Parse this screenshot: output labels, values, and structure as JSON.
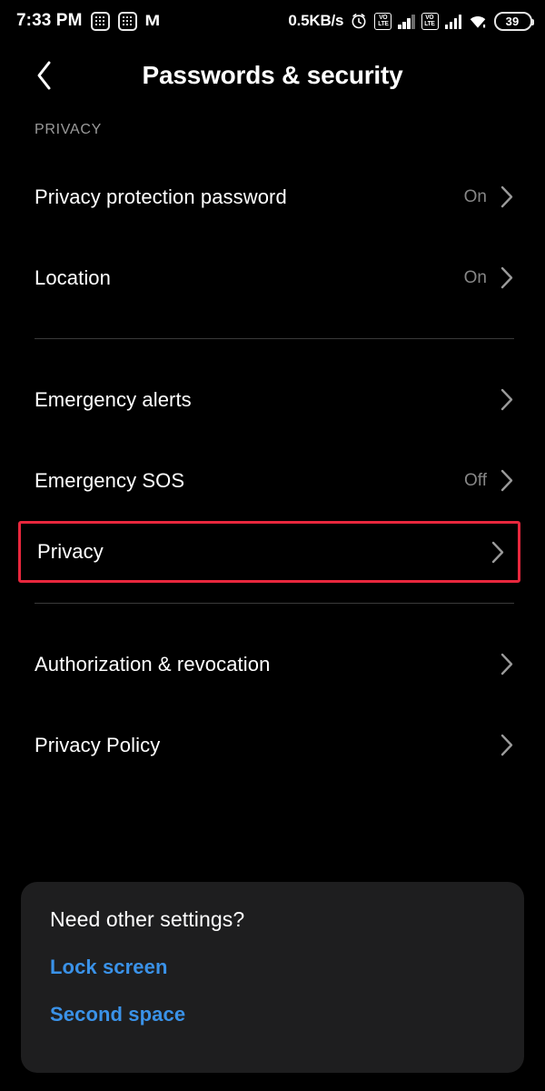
{
  "status_bar": {
    "time": "7:33 PM",
    "left_icons": [
      "app-badge-icon",
      "app-badge-icon",
      "m-logo-icon"
    ],
    "network_speed": "0.5KB/s",
    "right_icons": [
      "alarm-icon",
      "volte-icon",
      "signal-bars-icon",
      "volte-icon",
      "signal-bars-icon",
      "wifi-icon"
    ],
    "volte_label_top": "VO",
    "volte_label_bottom": "LTE",
    "battery_level": "39"
  },
  "header": {
    "back_icon": "chevron-left-icon",
    "title": "Passwords & security"
  },
  "section": {
    "label": "PRIVACY"
  },
  "list": {
    "groups": [
      {
        "items": [
          {
            "label": "Privacy protection password",
            "value": "On",
            "chevron": "chevron-right-icon",
            "highlighted": false
          },
          {
            "label": "Location",
            "value": "On",
            "chevron": "chevron-right-icon",
            "highlighted": false
          }
        ]
      },
      {
        "items": [
          {
            "label": "Emergency alerts",
            "value": "",
            "chevron": "chevron-right-icon",
            "highlighted": false
          },
          {
            "label": "Emergency SOS",
            "value": "Off",
            "chevron": "chevron-right-icon",
            "highlighted": false
          },
          {
            "label": "Privacy",
            "value": "",
            "chevron": "chevron-right-icon",
            "highlighted": true
          }
        ]
      },
      {
        "items": [
          {
            "label": "Authorization & revocation",
            "value": "",
            "chevron": "chevron-right-icon",
            "highlighted": false
          },
          {
            "label": "Privacy Policy",
            "value": "",
            "chevron": "chevron-right-icon",
            "highlighted": false
          }
        ]
      }
    ]
  },
  "footer_card": {
    "title": "Need other settings?",
    "links": [
      {
        "label": "Lock screen"
      },
      {
        "label": "Second space"
      }
    ]
  },
  "colors": {
    "background": "#000000",
    "card_background": "#1e1e1f",
    "primary_text": "#ffffff",
    "secondary_text": "#868686",
    "section_label": "#9a9a9a",
    "link_blue": "#3a92e8",
    "highlight_red": "#e8273d",
    "divider": "#3a3a3a"
  }
}
